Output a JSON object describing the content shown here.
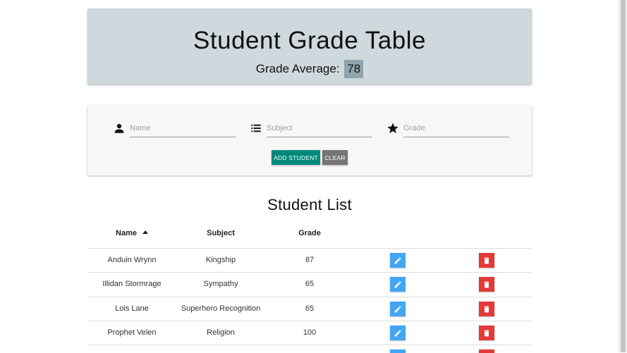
{
  "header": {
    "title": "Student Grade Table",
    "average_label": "Grade Average:",
    "average_value": "78"
  },
  "form": {
    "name_placeholder": "Name",
    "subject_placeholder": "Subject",
    "grade_placeholder": "Grade",
    "add_label": "ADD STUDENT",
    "clear_label": "CLEAR",
    "icons": [
      "person-icon",
      "list-icon",
      "star-icon"
    ]
  },
  "list": {
    "title": "Student List",
    "columns": [
      "Name",
      "Subject",
      "Grade"
    ],
    "sort": {
      "column": "Name",
      "direction": "ascending"
    },
    "rows": [
      {
        "name": "Anduin Wrynn",
        "subject": "Kingship",
        "grade": "87"
      },
      {
        "name": "Illidan Stormrage",
        "subject": "Sympathy",
        "grade": "65"
      },
      {
        "name": "Lois Lane",
        "subject": "Superhero Recognition",
        "grade": "65"
      },
      {
        "name": "Prophet Velen",
        "subject": "Religion",
        "grade": "100"
      }
    ]
  },
  "colors": {
    "header_bg": "#cfd8dc",
    "badge_bg": "#90a4ae",
    "add_button": "#00897b",
    "clear_button": "#757575",
    "edit_button": "#42a5f5",
    "delete_button": "#e53935"
  }
}
